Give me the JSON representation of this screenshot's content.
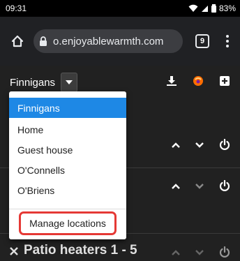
{
  "status_bar": {
    "time": "09:31",
    "battery": "83%"
  },
  "browser": {
    "url": "o.enjoyablewarmth.com",
    "tab_count": "9"
  },
  "app": {
    "selected_location": "Finnigans",
    "icons": [
      "download-icon",
      "heater-logo-icon",
      "add-icon"
    ]
  },
  "dropdown": {
    "items": [
      "Finnigans",
      "Home",
      "Guest house",
      "O'Connells",
      "O'Briens"
    ],
    "manage_label": "Manage locations"
  },
  "groups": [
    {
      "title": "Patio heaters 1 - 5"
    }
  ],
  "colors": {
    "accent": "#1e88e5",
    "highlight": "#e53935",
    "background": "#212121",
    "download_icon": "#ffffff",
    "logo": "#ff6d00"
  }
}
